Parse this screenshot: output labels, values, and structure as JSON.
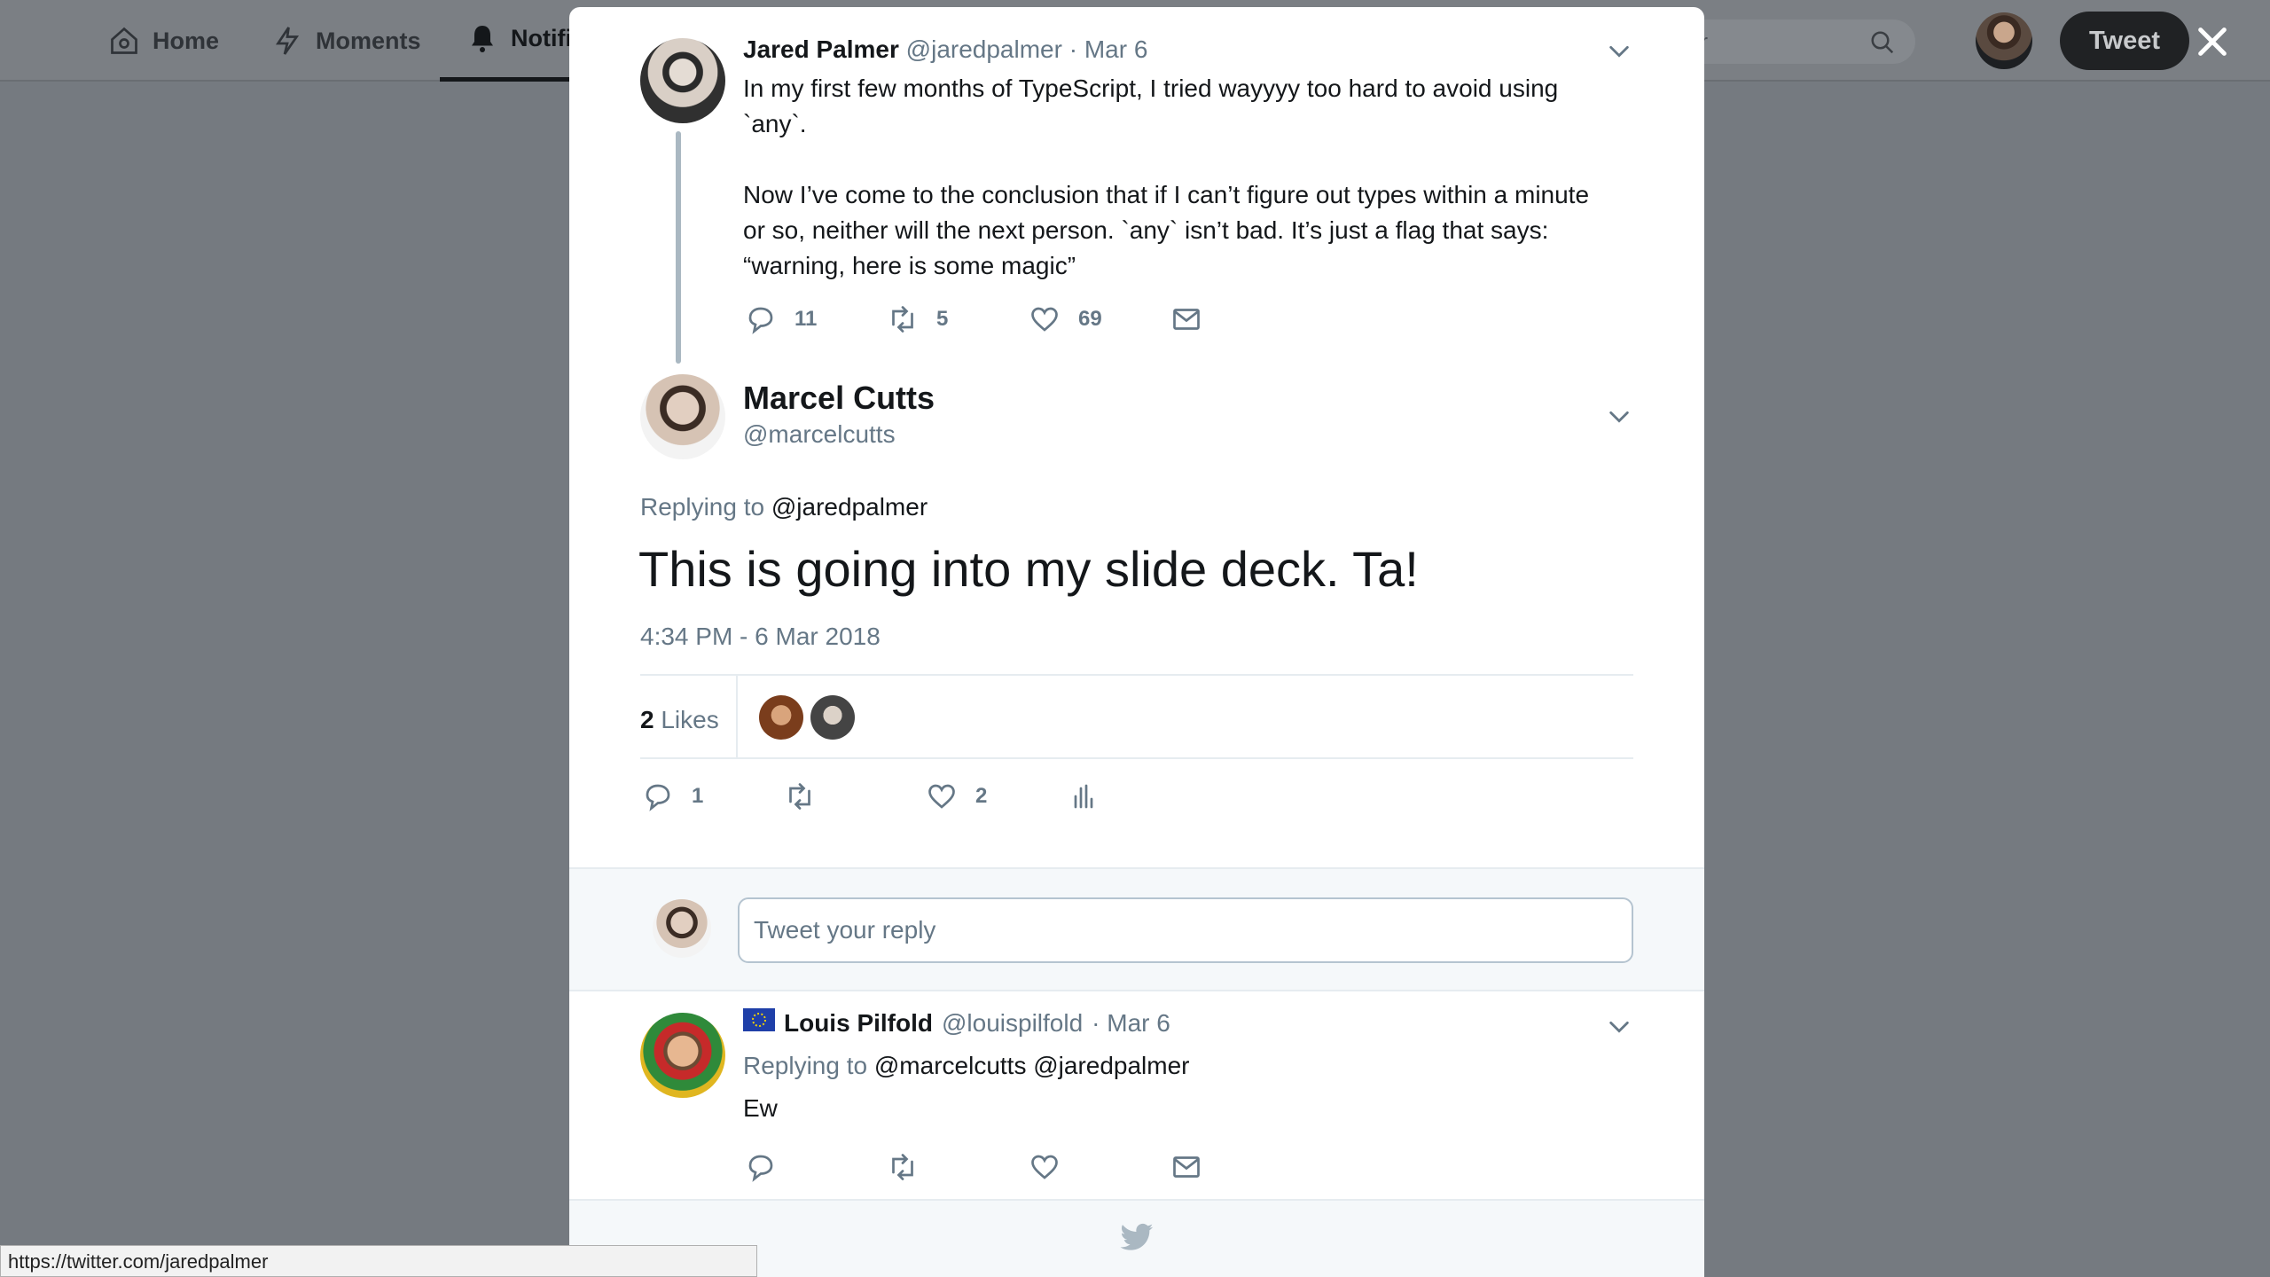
{
  "nav": {
    "home": "Home",
    "moments": "Moments",
    "notifications": "Notifi",
    "search_fragment": "r",
    "tweet_button": "Tweet"
  },
  "thread": {
    "parent": {
      "name": "Jared Palmer",
      "handle": "@jaredpalmer",
      "date": "· Mar 6",
      "text_lines": [
        "In my first few months of TypeScript, I tried wayyyy too hard to avoid using",
        "`any`.",
        "",
        "Now I’ve come to the conclusion that if I can’t figure out types within a minute",
        "or so, neither will the next person. `any` isn’t bad. It’s just a flag that says:",
        "“warning, here is some magic”"
      ],
      "replies": "11",
      "retweets": "5",
      "likes": "69"
    },
    "main": {
      "name": "Marcel Cutts",
      "handle": "@marcelcutts",
      "replying_prefix": "Replying to",
      "replying_to": "@jaredpalmer",
      "text": "This is going into my slide deck. Ta!",
      "timestamp": "4:34 PM - 6 Mar 2018",
      "likes_count": "2",
      "likes_label": "Likes",
      "replies": "1",
      "likes": "2"
    },
    "reply_box": {
      "placeholder": "Tweet your reply"
    },
    "reply": {
      "name": "Louis Pilfold",
      "handle": "@louispilfold",
      "date": "· Mar 6",
      "replying_prefix": "Replying to",
      "replying_to": "@marcelcutts @jaredpalmer",
      "text": "Ew"
    }
  },
  "status_bar": {
    "url": "https://twitter.com/jaredpalmer"
  },
  "colors": {
    "overlay": "#757a80",
    "muted": "#657786",
    "text": "#14171a"
  }
}
